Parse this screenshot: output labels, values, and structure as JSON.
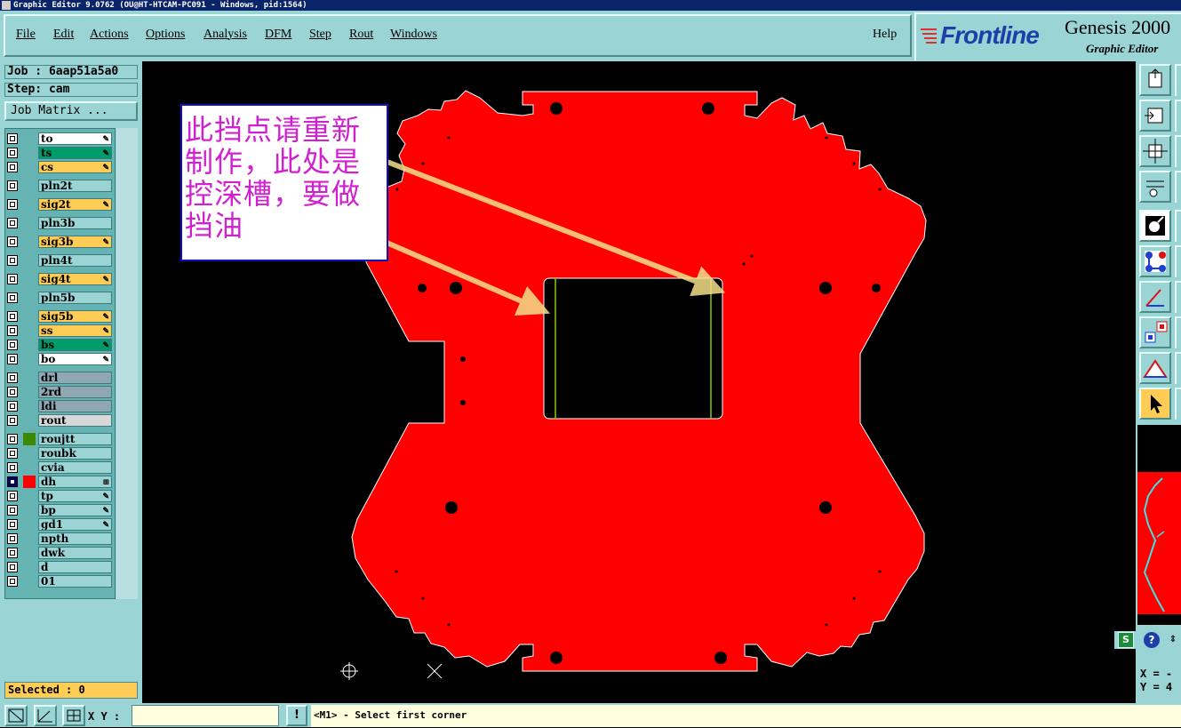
{
  "window": {
    "title": "Graphic Editor 9.0762 (OU@HT-HTCAM-PC091 - Windows, pid:1564)"
  },
  "menu": {
    "items": [
      "File",
      "Edit",
      "Actions",
      "Options",
      "Analysis",
      "DFM",
      "Step",
      "Rout",
      "Windows"
    ],
    "help": "Help"
  },
  "brand": {
    "logo": "Frontline",
    "product": "Genesis 2000",
    "subtitle": "Graphic Editor"
  },
  "job": {
    "job_label": "Job : 6aap51a5a0",
    "step_label": "Step: cam",
    "matrix_button": "Job Matrix ..."
  },
  "layers": [
    {
      "name": "to",
      "bg": "#ffffff",
      "editable": true
    },
    {
      "name": "ts",
      "bg": "#009b6b",
      "editable": true
    },
    {
      "name": "cs",
      "bg": "#ffcc55",
      "editable": true
    },
    {
      "name": "pln2t",
      "bg": "#9bd4d4",
      "editable": false
    },
    {
      "name": "sig2t",
      "bg": "#ffcc55",
      "editable": true
    },
    {
      "name": "pln3b",
      "bg": "#9bd4d4",
      "editable": false
    },
    {
      "name": "sig3b",
      "bg": "#ffcc55",
      "editable": true
    },
    {
      "name": "pln4t",
      "bg": "#9bd4d4",
      "editable": false
    },
    {
      "name": "sig4t",
      "bg": "#ffcc55",
      "editable": true
    },
    {
      "name": "pln5b",
      "bg": "#9bd4d4",
      "editable": false
    },
    {
      "name": "sig5b",
      "bg": "#ffcc55",
      "editable": true
    },
    {
      "name": "ss",
      "bg": "#ffcc55",
      "editable": true
    },
    {
      "name": "bs",
      "bg": "#009b6b",
      "editable": true
    },
    {
      "name": "bo",
      "bg": "#ffffff",
      "editable": true
    },
    {
      "name": "drl",
      "bg": "#8fa8b3",
      "editable": false
    },
    {
      "name": "2rd",
      "bg": "#8fa8b3",
      "editable": false
    },
    {
      "name": "ldi",
      "bg": "#8fa8b3",
      "editable": false
    },
    {
      "name": "rout",
      "bg": "#d8d8d8",
      "editable": false
    },
    {
      "name": "roujtt",
      "bg": "#9bd4d4",
      "editable": false,
      "marker": "#3a8a00"
    },
    {
      "name": "roubk",
      "bg": "#9bd4d4",
      "editable": false
    },
    {
      "name": "cvia",
      "bg": "#9bd4d4",
      "editable": false
    },
    {
      "name": "dh",
      "bg": "#9bd4d4",
      "editable": false,
      "marker": "#ff0000",
      "checked": true,
      "indicator": "⊞"
    },
    {
      "name": "tp",
      "bg": "#9bd4d4",
      "editable": true
    },
    {
      "name": "bp",
      "bg": "#9bd4d4",
      "editable": true
    },
    {
      "name": "gd1",
      "bg": "#9bd4d4",
      "editable": true
    },
    {
      "name": "npth",
      "bg": "#9bd4d4",
      "editable": false
    },
    {
      "name": "dwk",
      "bg": "#9bd4d4",
      "editable": false
    },
    {
      "name": "d",
      "bg": "#9bd4d4",
      "editable": false
    },
    {
      "name": "01",
      "bg": "#9bd4d4",
      "editable": false
    }
  ],
  "selected": "Selected : 0",
  "annotation": "此挡点请重新制作，此处是控深槽，要做挡油",
  "status": {
    "xy_label": "X Y :",
    "xy_value": "",
    "message": "<M1> - Select first corner",
    "alert": "!"
  },
  "coords": {
    "x": "X = -",
    "y": "Y = 4"
  },
  "colors": {
    "board": "#ff0000",
    "panel": "#9bd4d4",
    "annotation_text": "#d020d0",
    "arrow": "#f5e08a"
  },
  "icons": {
    "toolbar": [
      "fit-screen-icon",
      "zoom-home-icon",
      "pan-icon",
      "measure-icon",
      "snap-icon",
      "connect-icon",
      "line-icon",
      "move-icon",
      "triangle-icon",
      "pointer-icon"
    ],
    "status": [
      "zoom-window-icon",
      "ruler-icon",
      "grid-icon"
    ]
  }
}
